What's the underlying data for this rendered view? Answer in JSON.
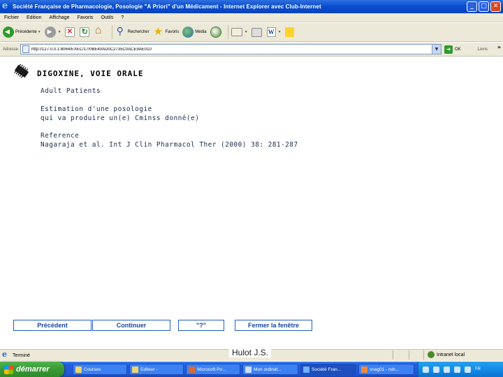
{
  "window": {
    "title": "Société Française de Pharmacologie, Posologie \"A Priori\" d'un Médicament - Internet Explorer avec Club-Internet"
  },
  "menu": {
    "items": [
      "Fichier",
      "Edition",
      "Affichage",
      "Favoris",
      "Outils",
      "?"
    ]
  },
  "toolbar": {
    "back_label": "Précédente",
    "search_label": "Rechercher",
    "favorites_label": "Favoris",
    "media_label": "Média"
  },
  "address": {
    "label": "Adresse",
    "url": "http://127.0.0.1:8064/EXEC/17/0BE40AD0C2735C0ACE9AE010",
    "go_label": "OK",
    "links_label": "Liens"
  },
  "content": {
    "drug_title": "DIGOXINE, VOIE ORALE",
    "patient_group": "Adult Patients",
    "estimation_line1": "Estimation d'une posologie",
    "estimation_line2": "qui va produire un(e) Cminss donné(e)",
    "reference_label": "Reference",
    "reference_text": "Nagaraja et al. Int J Clin Pharmacol Ther (2000) 38: 281-287"
  },
  "buttons": {
    "previous": "Précédent",
    "continue": "Continuer",
    "help": "\"?\"",
    "close": "Fermer la fenêtre"
  },
  "status": {
    "text": "Terminé",
    "zone": "Intranet local",
    "author": "Hulot J.S."
  },
  "taskbar": {
    "start_label": "démarrer",
    "tasks": [
      "Courses",
      "Editeur -",
      "Microsoft Po...",
      "Mon ordinat...",
      "Société Fran...",
      "snag01 - reb..."
    ],
    "tray_text": "FR"
  },
  "colors": {
    "titlebar": "#0a4fd0",
    "chrome": "#ece9d8",
    "button_border": "#1f5fc4",
    "button_text": "#1746a8",
    "taskbar": "#245edb",
    "start_button": "#3a9a36"
  },
  "icons": {
    "app": "ie-logo-icon",
    "drug": "pill-chip-icon",
    "back": "back-arrow-icon",
    "forward": "forward-arrow-icon",
    "stop": "stop-icon",
    "refresh": "refresh-icon",
    "home": "home-icon",
    "search": "search-icon",
    "favorites": "star-icon",
    "media": "media-icon",
    "history": "history-icon",
    "mail": "mail-icon",
    "print": "printer-icon",
    "word": "word-icon",
    "messenger": "note-icon"
  }
}
